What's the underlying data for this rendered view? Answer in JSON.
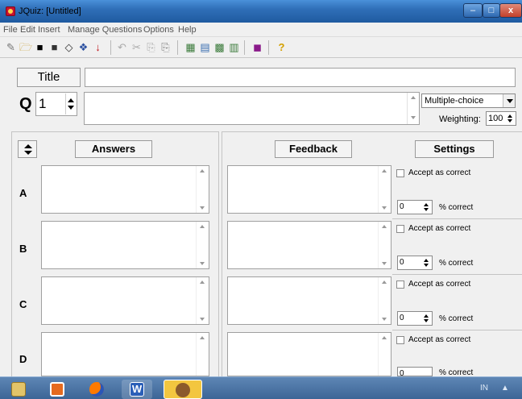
{
  "window": {
    "title": "JQuiz: [Untitled]",
    "min": "–",
    "max": "□",
    "close": "x"
  },
  "menu": [
    "File",
    "Edit",
    "Insert",
    "Manage Questions",
    "Options",
    "Help"
  ],
  "toolbar": {
    "icons": [
      "new-icon",
      "open-icon",
      "save-icon",
      "save-as-icon",
      "clear-icon",
      "web-icon",
      "down-arrow-icon",
      "undo-icon",
      "cut-icon",
      "copy-icon",
      "paste-icon",
      "add-picture-icon",
      "insert-link-icon",
      "media-icon",
      "config-icon",
      "export-icon",
      "help-icon"
    ],
    "glyphs": [
      "✎",
      "🗁",
      "■",
      "■",
      "◇",
      "❖",
      "↓",
      "↶",
      "✂",
      "⎘",
      "⎘",
      "▦",
      "▤",
      "▩",
      "▥",
      "◼",
      "?"
    ]
  },
  "title_button": "Title",
  "question": {
    "label": "Q",
    "number": "1",
    "type": "Multiple-choice",
    "weighting_label": "Weighting:",
    "weighting": "100"
  },
  "headers": {
    "answers": "Answers",
    "feedback": "Feedback",
    "settings": "Settings"
  },
  "answers": [
    {
      "letter": "A",
      "accept": "Accept as correct",
      "pct": "0",
      "pct_label": "% correct"
    },
    {
      "letter": "B",
      "accept": "Accept as correct",
      "pct": "0",
      "pct_label": "% correct"
    },
    {
      "letter": "C",
      "accept": "Accept as correct",
      "pct": "0",
      "pct_label": "% correct"
    },
    {
      "letter": "D",
      "accept": "Accept as correct",
      "pct": "0",
      "pct_label": "% correct"
    }
  ],
  "taskbar": {
    "apps": [
      "file-explorer",
      "media-player",
      "firefox",
      "word",
      "hot-potatoes-jquiz"
    ],
    "app_colors": [
      "#e2c46a",
      "#e56a1f",
      "#ff7a00",
      "#2b5fb8",
      "#f3c63f"
    ],
    "tray_lang": "IN",
    "tray_arrow": "▲"
  }
}
